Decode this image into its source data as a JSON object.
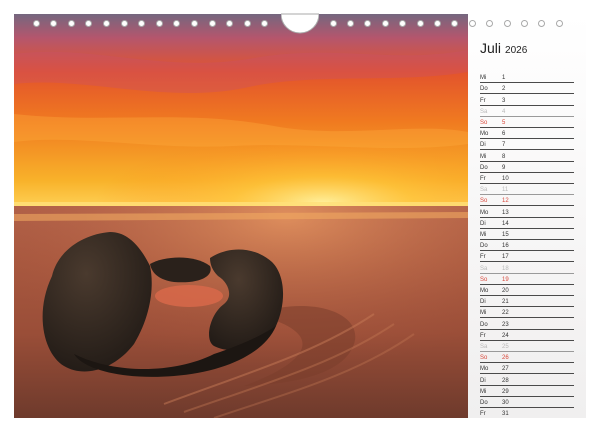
{
  "calendar": {
    "month": "Juli",
    "year": "2026",
    "days": [
      {
        "wd": "Mi",
        "day": "1",
        "type": "weekday"
      },
      {
        "wd": "Do",
        "day": "2",
        "type": "weekday"
      },
      {
        "wd": "Fr",
        "day": "3",
        "type": "weekday"
      },
      {
        "wd": "Sa",
        "day": "4",
        "type": "saturday"
      },
      {
        "wd": "So",
        "day": "5",
        "type": "sunday"
      },
      {
        "wd": "Mo",
        "day": "6",
        "type": "weekday"
      },
      {
        "wd": "Di",
        "day": "7",
        "type": "weekday"
      },
      {
        "wd": "Mi",
        "day": "8",
        "type": "weekday"
      },
      {
        "wd": "Do",
        "day": "9",
        "type": "weekday"
      },
      {
        "wd": "Fr",
        "day": "10",
        "type": "weekday"
      },
      {
        "wd": "Sa",
        "day": "11",
        "type": "saturday"
      },
      {
        "wd": "So",
        "day": "12",
        "type": "sunday"
      },
      {
        "wd": "Mo",
        "day": "13",
        "type": "weekday"
      },
      {
        "wd": "Di",
        "day": "14",
        "type": "weekday"
      },
      {
        "wd": "Mi",
        "day": "15",
        "type": "weekday"
      },
      {
        "wd": "Do",
        "day": "16",
        "type": "weekday"
      },
      {
        "wd": "Fr",
        "day": "17",
        "type": "weekday"
      },
      {
        "wd": "Sa",
        "day": "18",
        "type": "saturday"
      },
      {
        "wd": "So",
        "day": "19",
        "type": "sunday"
      },
      {
        "wd": "Mo",
        "day": "20",
        "type": "weekday"
      },
      {
        "wd": "Di",
        "day": "21",
        "type": "weekday"
      },
      {
        "wd": "Mi",
        "day": "22",
        "type": "weekday"
      },
      {
        "wd": "Do",
        "day": "23",
        "type": "weekday"
      },
      {
        "wd": "Fr",
        "day": "24",
        "type": "weekday"
      },
      {
        "wd": "Sa",
        "day": "25",
        "type": "saturday"
      },
      {
        "wd": "So",
        "day": "26",
        "type": "sunday"
      },
      {
        "wd": "Mo",
        "day": "27",
        "type": "weekday"
      },
      {
        "wd": "Di",
        "day": "28",
        "type": "weekday"
      },
      {
        "wd": "Mi",
        "day": "29",
        "type": "weekday"
      },
      {
        "wd": "Do",
        "day": "30",
        "type": "weekday"
      },
      {
        "wd": "Fr",
        "day": "31",
        "type": "weekday"
      }
    ]
  },
  "colors": {
    "sunday": "#d9473a",
    "saturday": "#b9b9b9",
    "sky_top": "#7a6a86",
    "sky_glow": "#f6a21a",
    "rock": "#2e2620"
  }
}
